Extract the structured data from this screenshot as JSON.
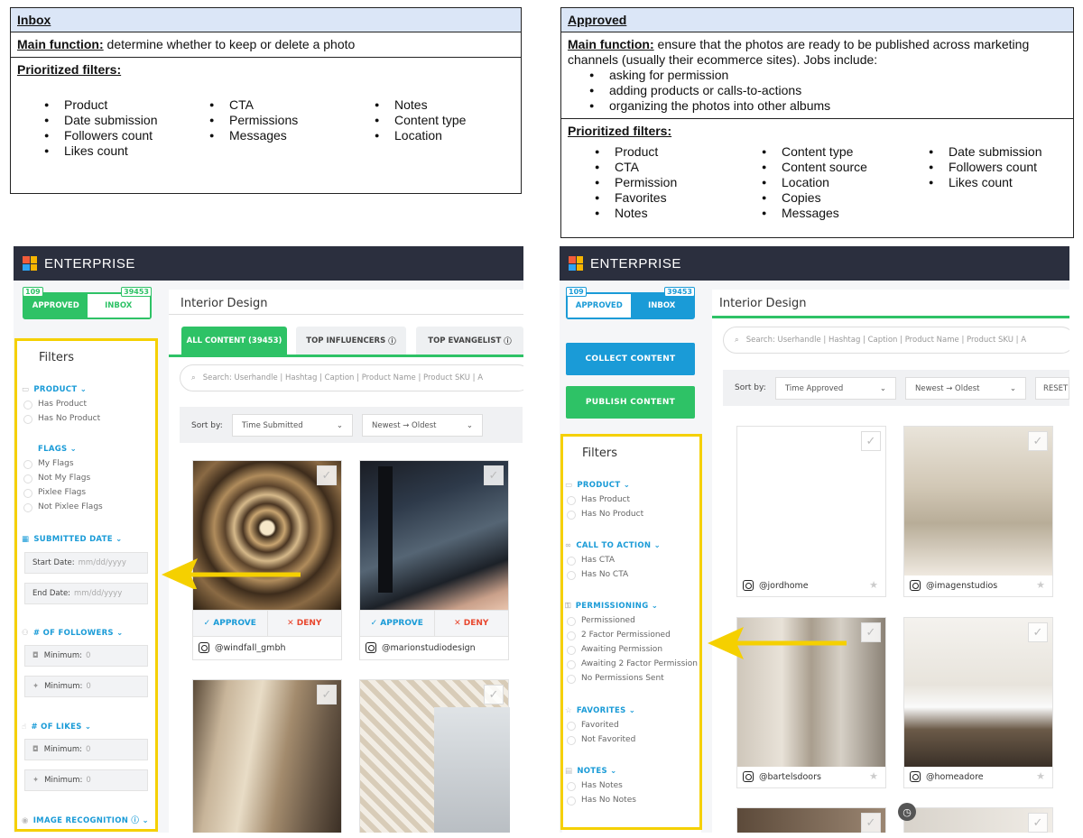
{
  "inbox_box": {
    "title": "Inbox",
    "main_function_label": "Main function:",
    "main_function_text": " determine whether to keep or delete a photo",
    "filters_label": "Prioritized filters:",
    "col1": [
      "Product",
      "Date submission",
      "Followers count",
      "Likes count"
    ],
    "col2": [
      "CTA",
      "Permissions",
      "Messages"
    ],
    "col3": [
      "Notes",
      "Content type",
      "Location"
    ]
  },
  "approved_box": {
    "title": "Approved",
    "main_function_label": "Main function:",
    "main_function_text": " ensure that the photos are ready to be published across marketing channels (usually their ecommerce sites). Jobs include:",
    "jobs": [
      "asking for permission",
      "adding products or calls-to-actions",
      "organizing the photos into other albums"
    ],
    "filters_label": "Prioritized filters:",
    "col1": [
      "Product",
      "CTA",
      "Permission",
      "Favorites",
      "Notes"
    ],
    "col2": [
      "Content type",
      "Content source",
      "Location",
      "Copies",
      "Messages"
    ],
    "col3": [
      "Date submission",
      "Followers count",
      "Likes count"
    ]
  },
  "left_app": {
    "brand": "ENTERPRISE",
    "approved_label": "APPROVED",
    "approved_count": "109",
    "inbox_label": "INBOX",
    "inbox_count": "39453",
    "album_title": "Interior Design",
    "tabs": [
      "ALL CONTENT (39453)",
      "TOP INFLUENCERS",
      "TOP EVANGELIST"
    ],
    "search_placeholder": "Search:  Userhandle  |  Hashtag  |  Caption  |  Product Name  |  Product SKU  |  A",
    "sort_label": "Sort by:",
    "sort_field": "Time Submitted",
    "sort_order": "Newest → Oldest",
    "filters_title": "Filters",
    "product_section": "PRODUCT",
    "product_opts": [
      "Has Product",
      "Has No Product"
    ],
    "flags_section": "FLAGS",
    "flags_opts": [
      "My Flags",
      "Not My Flags",
      "Pixlee Flags",
      "Not Pixlee Flags"
    ],
    "date_section": "SUBMITTED DATE",
    "start_date_label": "Start Date:",
    "end_date_label": "End Date:",
    "date_placeholder": "mm/dd/yyyy",
    "followers_section": "# OF FOLLOWERS",
    "likes_section": "# OF LIKES",
    "minimum_label": "Minimum:",
    "minimum_value": "0",
    "image_recognition": "IMAGE RECOGNITION",
    "approve": "✓ APPROVE",
    "deny": "✕ DENY",
    "handles": [
      "@windfall_gmbh",
      "@marionstudiodesign"
    ]
  },
  "right_app": {
    "brand": "ENTERPRISE",
    "approved_label": "APPROVED",
    "approved_count": "109",
    "inbox_label": "INBOX",
    "inbox_count": "39453",
    "album_title": "Interior Design",
    "search_placeholder": "Search:  Userhandle  |  Hashtag  |  Caption  |  Product Name  |  Product SKU  |  A",
    "collect": "COLLECT CONTENT",
    "publish": "PUBLISH CONTENT",
    "sort_label": "Sort by:",
    "sort_field": "Time Approved",
    "sort_order": "Newest → Oldest",
    "reset": "RESET",
    "filters_title": "Filters",
    "product_section": "PRODUCT",
    "product_opts": [
      "Has Product",
      "Has No Product"
    ],
    "cta_section": "CALL TO ACTION",
    "cta_opts": [
      "Has CTA",
      "Has No CTA"
    ],
    "perm_section": "PERMISSIONING",
    "perm_opts": [
      "Permissioned",
      "2 Factor Permissioned",
      "Awaiting Permission",
      "Awaiting 2 Factor Permission",
      "No Permissions Sent"
    ],
    "fav_section": "FAVORITES",
    "fav_opts": [
      "Favorited",
      "Not Favorited"
    ],
    "notes_section": "NOTES",
    "notes_opts": [
      "Has Notes",
      "Has No Notes"
    ],
    "handles": [
      "@jordhome",
      "@imagenstudios",
      "@bartelsdoors",
      "@homeadore"
    ]
  },
  "colors": {
    "green": "#2ec266",
    "blue": "#1a9bd7",
    "yellow": "#f5d000",
    "topbar": "#2b2f3e"
  }
}
